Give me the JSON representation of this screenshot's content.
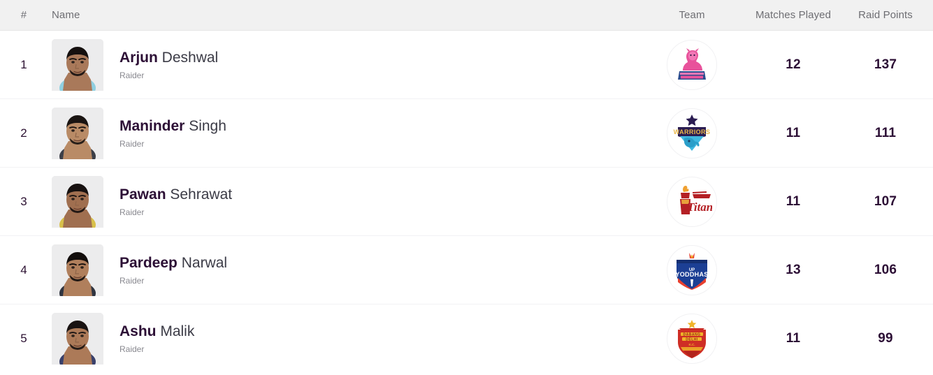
{
  "table": {
    "columns": {
      "rank": "#",
      "name": "Name",
      "team": "Team",
      "matches_played": "Matches Played",
      "raid_points": "Raid Points"
    },
    "rows": [
      {
        "rank": "1",
        "first_name": "Arjun",
        "last_name": "Deshwal",
        "role": "Raider",
        "team_name": "Jaipur Pink Panthers",
        "team_logo_icon": "jaipur-pink-panthers-logo-icon",
        "matches_played": "12",
        "raid_points": "137"
      },
      {
        "rank": "2",
        "first_name": "Maninder",
        "last_name": "Singh",
        "role": "Raider",
        "team_name": "Bengal Warriors",
        "team_logo_icon": "bengal-warriors-logo-icon",
        "matches_played": "11",
        "raid_points": "111"
      },
      {
        "rank": "3",
        "first_name": "Pawan",
        "last_name": "Sehrawat",
        "role": "Raider",
        "team_name": "Telugu Titans",
        "team_logo_icon": "telugu-titans-logo-icon",
        "matches_played": "11",
        "raid_points": "107"
      },
      {
        "rank": "4",
        "first_name": "Pardeep",
        "last_name": "Narwal",
        "role": "Raider",
        "team_name": "UP Yoddhas",
        "team_logo_icon": "up-yoddhas-logo-icon",
        "matches_played": "13",
        "raid_points": "106"
      },
      {
        "rank": "5",
        "first_name": "Ashu",
        "last_name": "Malik",
        "role": "Raider",
        "team_name": "Dabang Delhi",
        "team_logo_icon": "dabang-delhi-logo-icon",
        "matches_played": "11",
        "raid_points": "99"
      }
    ]
  },
  "colors": {
    "header_bg": "#f1f1f1",
    "header_text": "#6e6e73",
    "name_accent": "#2c0f35",
    "name_text": "#3b3b46",
    "role_text": "#88888f",
    "row_divider": "#f2f2f4",
    "avatar_bg": "#ececed"
  }
}
